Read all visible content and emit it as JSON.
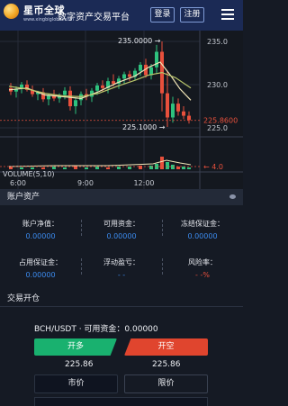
{
  "header": {
    "brand": "星币全球",
    "brand_url": "www.xingbiglobal.com",
    "slogan": "数字资产交易平台",
    "login_label": "登录",
    "register_label": "注册"
  },
  "chart": {
    "high_label": "235.0000",
    "low_label": "225.1000",
    "last_price": "225.8600",
    "volume_title": "VOLUME(5,10)",
    "volume_value": "4.0",
    "y_axis": [
      "235.0",
      "230.0",
      "225.0"
    ],
    "x_axis": [
      "6:00",
      "9:00",
      "12:00"
    ],
    "colors": {
      "up": "#2ec27e",
      "down": "#e8503c",
      "ma_short": "#f2e6b8",
      "ma_long": "#b8c46a"
    }
  },
  "chart_data": {
    "type": "candlestick",
    "y_ticks": [
      235,
      230,
      225
    ],
    "x_ticks": [
      "6:00",
      "9:00",
      "12:00"
    ],
    "annotations": [
      {
        "text": "235.0000",
        "kind": "high"
      },
      {
        "text": "225.1000",
        "kind": "low"
      },
      {
        "text": "225.8600",
        "kind": "last"
      }
    ]
  },
  "account": {
    "title": "账户资产",
    "net_value_label": "账户净值：",
    "net_value": "0.00000",
    "available_label": "可用资金：",
    "available": "0.00000",
    "frozen_label": "冻结保证金：",
    "frozen": "0.00000",
    "margin_label": "占用保证金：",
    "margin": "0.00000",
    "floating_label": "浮动盈亏：",
    "floating": "- -",
    "risk_label": "风险率：",
    "risk": "- -%"
  },
  "trade": {
    "title": "交易开仓",
    "pair_text": "BCH/USDT · 可用资金：0.00000",
    "long_label": "开多",
    "short_label": "开空",
    "long_price": "225.86",
    "short_price": "225.86",
    "market_label": "市价",
    "limit_label": "限价"
  }
}
